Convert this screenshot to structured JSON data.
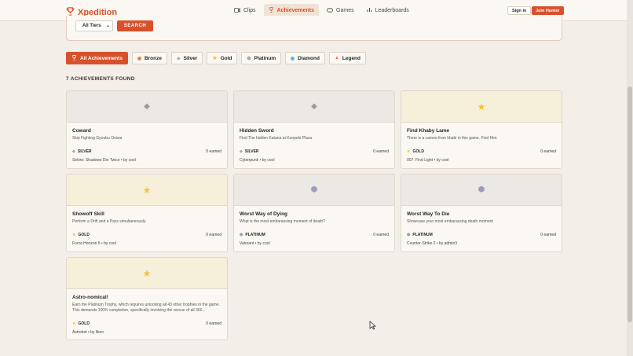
{
  "header": {
    "logo_text": "Xpedition",
    "nav": [
      {
        "label": "Clips",
        "icon": "video-icon"
      },
      {
        "label": "Achievements",
        "icon": "trophy-icon",
        "active": true
      },
      {
        "label": "Games",
        "icon": "gamepad-icon"
      },
      {
        "label": "Leaderboards",
        "icon": "bar-chart-icon"
      }
    ],
    "signin_label": "Sign in",
    "join_label": "Join Hunter"
  },
  "filter": {
    "tier_select_value": "All Tiers",
    "search_label": "SEARCH"
  },
  "tabs": [
    {
      "label": "All Achievements",
      "active": true,
      "color": "#ffffff"
    },
    {
      "label": "Bronze",
      "color": "#d98a4c"
    },
    {
      "label": "Silver",
      "color": "#b5b5b5"
    },
    {
      "label": "Gold",
      "color": "#f2c23a"
    },
    {
      "label": "Platinum",
      "color": "#a7a6c2"
    },
    {
      "label": "Diamond",
      "color": "#55b8e0"
    },
    {
      "label": "Legend",
      "color": "#e5774d"
    }
  ],
  "results": {
    "count_text": "7 ACHIEVEMENTS FOUND"
  },
  "colors": {
    "accent": "#d8502c",
    "gold": "#f2c23a",
    "silver": "#a9a9a9",
    "platinum": "#9d9cba"
  },
  "cards": [
    {
      "title": "Coward",
      "desc": "Skip Fighting Gyoubu Oniwa",
      "tier": "SILVER",
      "earned": "0 earned",
      "game": "Sekiro: Shadows Die Twice • by cool",
      "icon": "diamond-icon"
    },
    {
      "title": "Hidden Sword",
      "desc": "Find The hidden Katana at Konpeki Plaza",
      "tier": "SILVER",
      "earned": "0 earned",
      "game": "Cyberpunk • by cool",
      "icon": "diamond-icon"
    },
    {
      "title": "Find Khaby Lame",
      "desc": "There is a cameo from khabi in this game. Find Him",
      "tier": "GOLD",
      "earned": "0 earned",
      "game": "007: First Light • by cool",
      "icon": "star-icon"
    },
    {
      "title": "Showoff Skill",
      "desc": "Perform a Drift and a Pass simultaneously.",
      "tier": "GOLD",
      "earned": "0 earned",
      "game": "Forza Horizon 5 • by cool",
      "icon": "star-icon"
    },
    {
      "title": "Worst Way of Dying",
      "desc": "What is the most embarassing moment of death?",
      "tier": "PLATINUM",
      "earned": "0 earned",
      "game": "Valorant • by cool",
      "icon": "hexagon-icon"
    },
    {
      "title": "Worst Way To Die",
      "desc": "Showcase your most embarassing death moment",
      "tier": "PLATINUM",
      "earned": "0 earned",
      "game": "Counter-Strike 2 • by admin3",
      "icon": "hexagon-icon"
    },
    {
      "title": "Astro-nomical!",
      "desc": "Earn the Platinum Trophy, which requires unlocking all 43 other trophies in the game. This demands 100% completion, specifically involving the rescue of all 300...",
      "tier": "GOLD",
      "earned": "0 earned",
      "game": "Astrobot • by liken",
      "icon": "star-icon"
    }
  ]
}
